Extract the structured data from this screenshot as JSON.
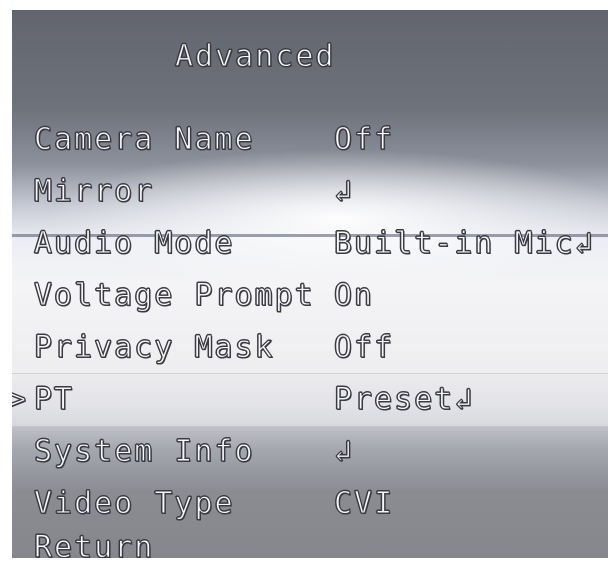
{
  "menu": {
    "title": "Advanced",
    "selected_index": 5,
    "cursor": ">",
    "items": [
      {
        "label": "Camera Name",
        "value": "Off"
      },
      {
        "label": "Mirror",
        "value": "↲"
      },
      {
        "label": "Audio Mode",
        "value": "Built-in Mic↲"
      },
      {
        "label": "Voltage Prompt",
        "value": "On"
      },
      {
        "label": "Privacy Mask",
        "value": "Off"
      },
      {
        "label": "PT",
        "value": "Preset↲"
      },
      {
        "label": "System Info",
        "value": "↲"
      },
      {
        "label": "Video Type",
        "value": "CVI"
      },
      {
        "label": "Return",
        "value": ""
      }
    ]
  }
}
